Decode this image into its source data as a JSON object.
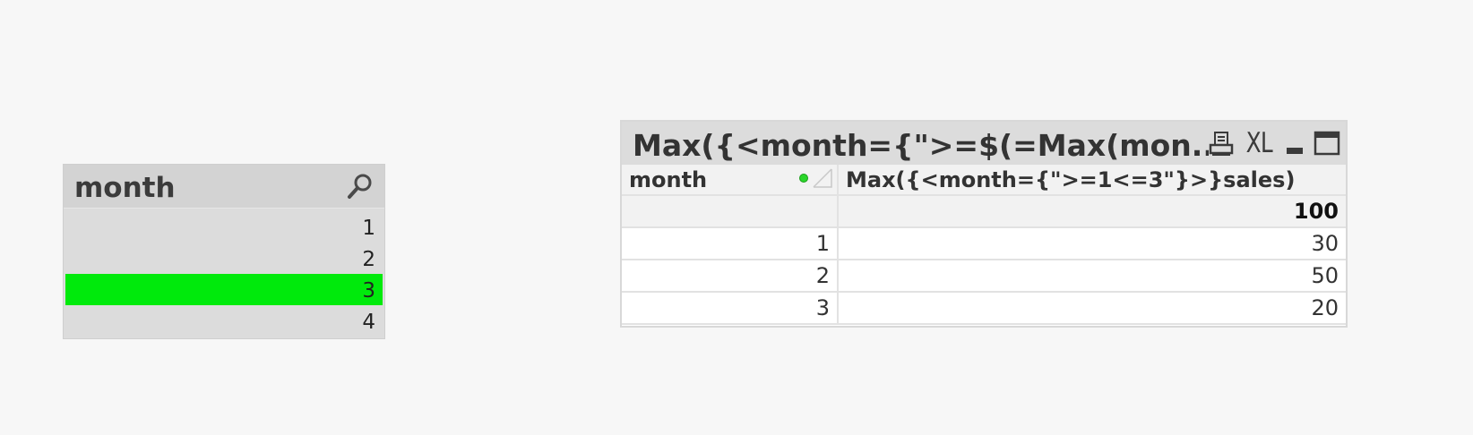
{
  "listbox": {
    "title": "month",
    "items": [
      {
        "label": "1",
        "selected": false
      },
      {
        "label": "2",
        "selected": false
      },
      {
        "label": "3",
        "selected": true
      },
      {
        "label": "4",
        "selected": false
      }
    ],
    "selected_color": "#00ea0c"
  },
  "table": {
    "caption": "Max({<month={\">=$(=Max(mon...",
    "icons": [
      "print-icon",
      "export-excel-icon",
      "minimize-icon",
      "maximize-icon"
    ],
    "xl_label": "XL",
    "columns": [
      "month",
      "Max({<month={\">=1<=3\"}>}sales)"
    ],
    "total_row": [
      "",
      "100"
    ],
    "rows": [
      [
        "1",
        "30"
      ],
      [
        "2",
        "50"
      ],
      [
        "3",
        "20"
      ]
    ]
  }
}
